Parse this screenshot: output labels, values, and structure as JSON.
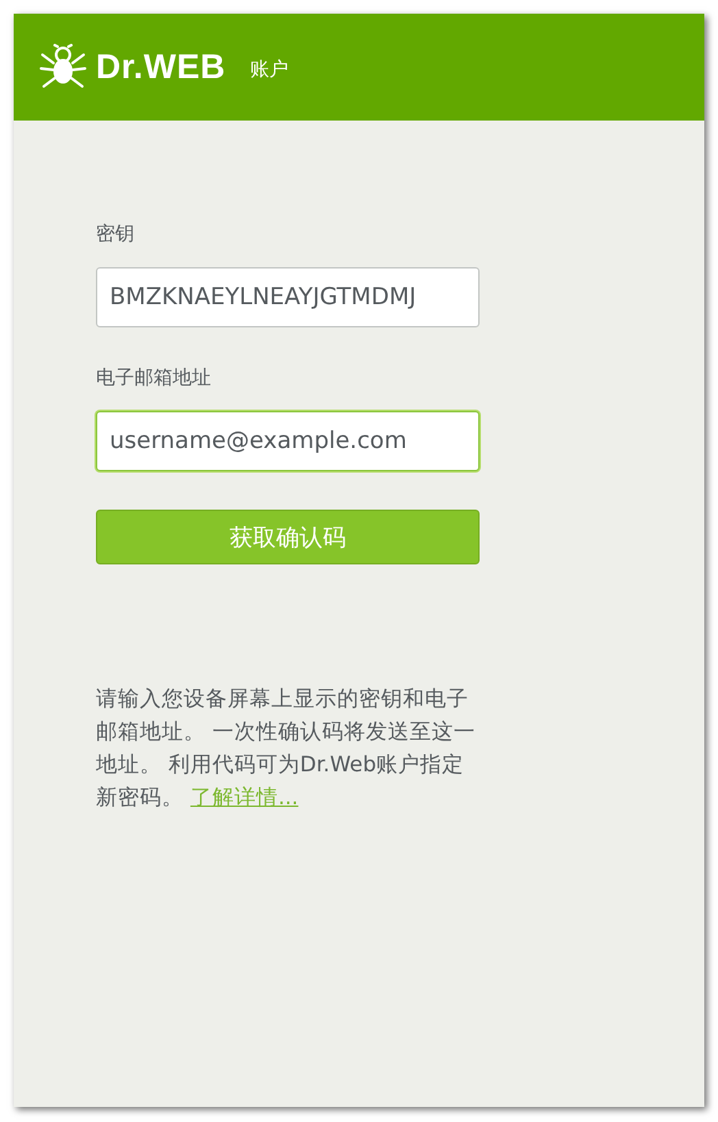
{
  "header": {
    "logo_text": "Dr.WEB",
    "title": "账户"
  },
  "fields": [
    {
      "label": "密钥",
      "value": "BMZKNAEYLNEAYJGTMDMJ",
      "focused": false
    },
    {
      "label": "电子邮箱地址",
      "value": "username@example.com",
      "focused": true
    }
  ],
  "submit_button": "获取确认码",
  "info": {
    "text": "请输入您设备屏幕上显示的密钥和电子邮箱地址。 一次性确认码将发送至这一地址。 利用代码可为Dr.Web账户指定新密码。 ",
    "link": "了解详情..."
  }
}
